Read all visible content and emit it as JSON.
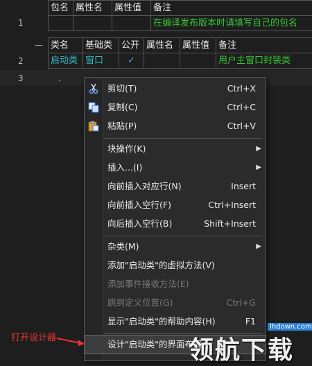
{
  "package_table": {
    "line": "1",
    "headers": [
      "包名",
      "属性名",
      "属性值",
      "备注"
    ],
    "row": [
      "",
      "",
      "",
      "在编译发布版本时请填写自己的包名"
    ]
  },
  "class_table": {
    "collapse": "—",
    "line": "2",
    "headers": [
      "类名",
      "基础类",
      "公开",
      "属性名",
      "属性值",
      "备注"
    ],
    "row": [
      "启动类",
      "窗口",
      "✓",
      "",
      "",
      "用户主窗口封装类"
    ]
  },
  "line3": {
    "line": "3",
    "content": "."
  },
  "context_menu": {
    "items": [
      {
        "label": "剪切(T)",
        "shortcut": "Ctrl+X",
        "icon": "scissors-icon"
      },
      {
        "label": "复制(C)",
        "shortcut": "Ctrl+C",
        "icon": "copy-icon"
      },
      {
        "label": "粘贴(P)",
        "shortcut": "Ctrl+V",
        "icon": "paste-icon"
      },
      {
        "label": "块操作(K)",
        "submenu": true
      },
      {
        "label": "插入...(I)",
        "submenu": true
      },
      {
        "label": "向前插入对应行(N)",
        "shortcut": "Insert"
      },
      {
        "label": "向前插入空行(F)",
        "shortcut": "Ctrl+Insert"
      },
      {
        "label": "向后插入空行(B)",
        "shortcut": "Shift+Insert"
      },
      {
        "label": "杂类(M)",
        "submenu": true
      },
      {
        "label": "添加\"启动类\"的虚拟方法(V)"
      },
      {
        "label": "添加事件接收方法(E)",
        "disabled": true
      },
      {
        "label": "跳到定义位置(G)",
        "shortcut": "Ctrl+G",
        "disabled": true
      },
      {
        "label": "显示\"启动类\"的帮助内容(H)",
        "shortcut": "F1"
      },
      {
        "label": "设计\"启动类\"的界面布局"
      }
    ]
  },
  "annotation": "打开设计器",
  "watermark": {
    "site": "lhdown.com",
    "text": "领航下载"
  }
}
